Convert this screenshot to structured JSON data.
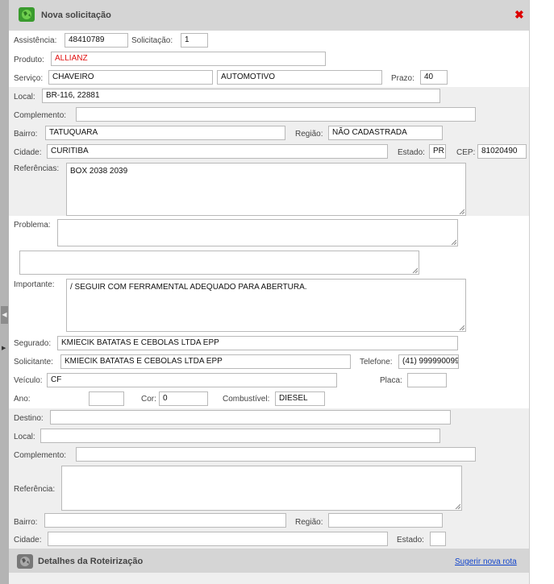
{
  "header": {
    "title": "Nova solicitação"
  },
  "form": {
    "assistencia": {
      "label": "Assistência:",
      "value": "48410789"
    },
    "solicitacao": {
      "label": "Solicitação:",
      "value": "1"
    },
    "produto": {
      "label": "Produto:",
      "value": "ALLIANZ"
    },
    "servico": {
      "label": "Serviço:",
      "value1": "CHAVEIRO",
      "value2": "AUTOMOTIVO"
    },
    "prazo": {
      "label": "Prazo:",
      "value": "40"
    },
    "local": {
      "label": "Local:",
      "value": "BR-116, 22881"
    },
    "complemento": {
      "label": "Complemento:",
      "value": ""
    },
    "bairro": {
      "label": "Bairro:",
      "value": "TATUQUARA"
    },
    "regiao": {
      "label": "Região:",
      "value": "NÃO CADASTRADA"
    },
    "cidade": {
      "label": "Cidade:",
      "value": "CURITIBA"
    },
    "estado": {
      "label": "Estado:",
      "value": "PR"
    },
    "cep": {
      "label": "CEP:",
      "value": "81020490"
    },
    "referencias": {
      "label": "Referências:",
      "value": "BOX 2038 2039"
    },
    "problema": {
      "label": "Problema:",
      "value": "",
      "value2": ""
    },
    "importante": {
      "label": "Importante:",
      "value": "/ SEGUIR COM FERRAMENTAL ADEQUADO PARA ABERTURA."
    },
    "segurado": {
      "label": "Segurado:",
      "value": "KMIECIK BATATAS E CEBOLAS LTDA EPP"
    },
    "solicitante": {
      "label": "Solicitante:",
      "value": "KMIECIK BATATAS E CEBOLAS LTDA EPP"
    },
    "telefone": {
      "label": "Telefone:",
      "value": "(41) 999990099"
    },
    "veiculo": {
      "label": "Veículo:",
      "value": "CF"
    },
    "placa": {
      "label": "Placa:",
      "value": ""
    },
    "ano": {
      "label": "Ano:",
      "value": ""
    },
    "cor": {
      "label": "Cor:",
      "value": "0"
    },
    "combustivel": {
      "label": "Combustível:",
      "value": "DIESEL"
    }
  },
  "destino": {
    "destino": {
      "label": "Destino:",
      "value": ""
    },
    "local": {
      "label": "Local:",
      "value": ""
    },
    "complemento": {
      "label": "Complemento:",
      "value": ""
    },
    "referencia": {
      "label": "Referência:",
      "value": ""
    },
    "bairro": {
      "label": "Bairro:",
      "value": ""
    },
    "regiao": {
      "label": "Região:",
      "value": ""
    },
    "cidade": {
      "label": "Cidade:",
      "value": ""
    },
    "estado": {
      "label": "Estado:",
      "value": ""
    }
  },
  "footer": {
    "title": "Detalhes da Roteirização",
    "link": "Sugerir nova rota"
  },
  "icons": {
    "header_icon": "globe-map-icon",
    "close_icon": "close-x-icon",
    "footer_icon": "globe-route-icon"
  },
  "colors": {
    "header_bg": "#d5d5d5",
    "band_bg": "#efefef",
    "accent_red": "#e01010",
    "link_blue": "#1144cc"
  }
}
